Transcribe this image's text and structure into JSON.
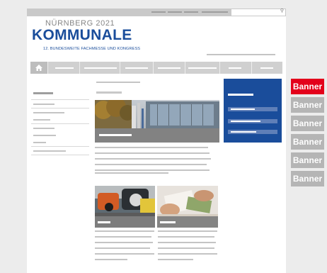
{
  "header": {
    "logo_year_line": "NÜRNBERG 2021",
    "logo_word": "KOMMUNALE",
    "logo_tagline": "12. BUNDESWEITE FACHMESSE UND KONGRESS"
  },
  "nav": {
    "home_icon": "home-icon",
    "item_count": 7
  },
  "banners": [
    "Banner",
    "Banner",
    "Banner",
    "Banner",
    "Banner",
    "Banner"
  ],
  "colors": {
    "brand_blue": "#1a4d9b",
    "logo_gray": "#878787",
    "banner_active": "#e3001b",
    "banner_inactive": "#b5b5b5",
    "caption_gray": "#888888"
  }
}
